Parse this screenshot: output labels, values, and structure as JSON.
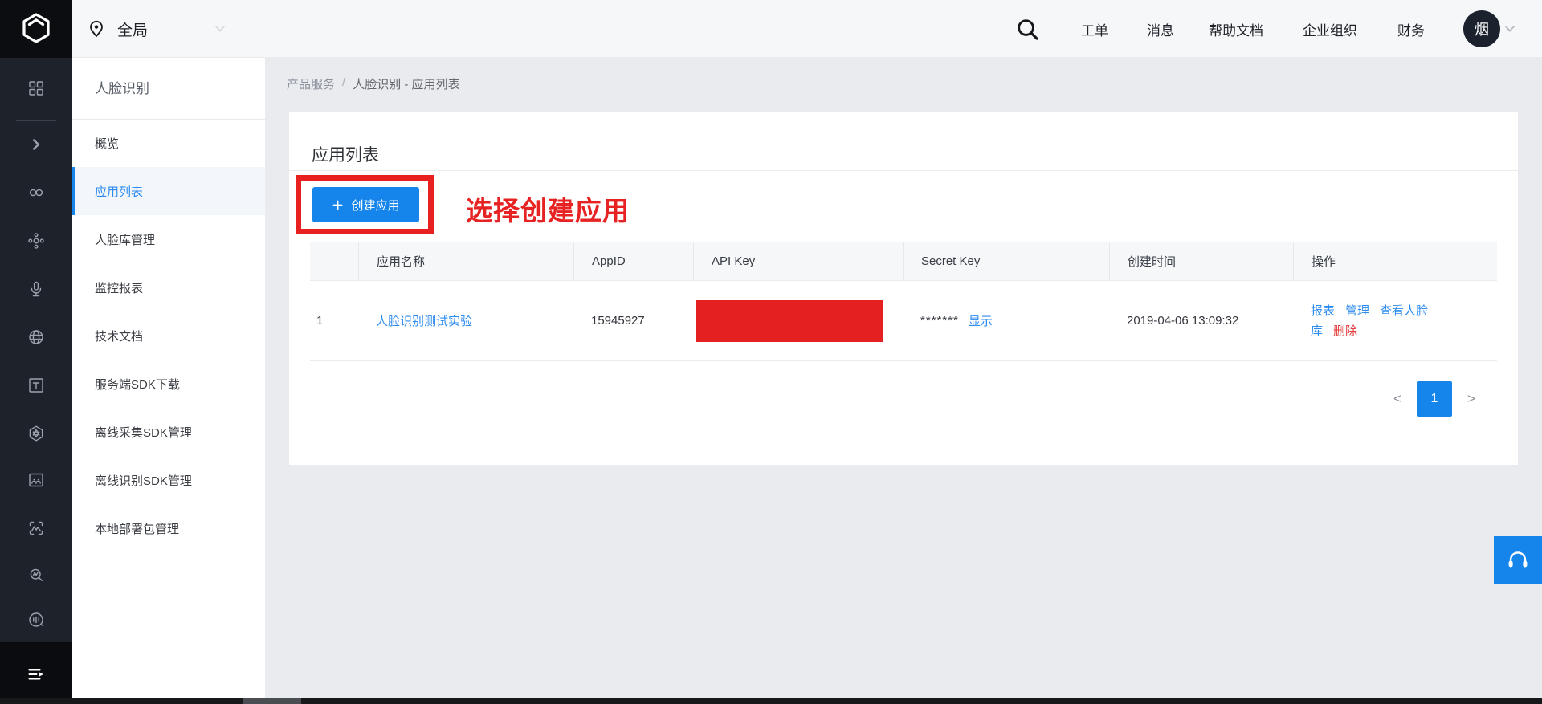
{
  "topbar": {
    "region_label": "全局",
    "nav": [
      "工单",
      "消息",
      "帮助文档",
      "企业组织",
      "财务"
    ],
    "avatar_text": "烟"
  },
  "rail_icons": [
    "grid-products",
    "collapse-chevron",
    "infinity",
    "node-cluster",
    "microphone",
    "face-globe",
    "text-recognition",
    "star-hexagon",
    "image-recognition",
    "face-scan",
    "search-wave",
    "voice-circle",
    "list-menu"
  ],
  "sidebar": {
    "title": "人脸识别",
    "items": [
      {
        "label": "概览"
      },
      {
        "label": "应用列表"
      },
      {
        "label": "人脸库管理"
      },
      {
        "label": "监控报表"
      },
      {
        "label": "技术文档"
      },
      {
        "label": "服务端SDK下载"
      },
      {
        "label": "离线采集SDK管理"
      },
      {
        "label": "离线识别SDK管理"
      },
      {
        "label": "本地部署包管理"
      }
    ]
  },
  "breadcrumb": {
    "root": "产品服务",
    "sep": "/",
    "current": "人脸识别 - 应用列表"
  },
  "main": {
    "card_title": "应用列表",
    "create_button_label": "创建应用",
    "annotation_text": "选择创建应用",
    "table": {
      "headers": [
        "",
        "应用名称",
        "AppID",
        "API Key",
        "Secret Key",
        "创建时间",
        "操作"
      ],
      "rows": [
        {
          "index": "1",
          "name": "人脸识别测试实验",
          "app_id": "15945927",
          "secret_mask": "*******",
          "secret_toggle": "显示",
          "created": "2019-04-06 13:09:32",
          "ops": [
            "报表",
            "管理",
            "查看人脸库",
            "删除"
          ]
        }
      ]
    },
    "pagination": {
      "prev": "<",
      "page": "1",
      "next": ">"
    }
  },
  "colors": {
    "accent_blue": "#1585ec",
    "link_blue": "#2d8cf0",
    "annotation_red": "#e82020",
    "redaction_red": "#e42020",
    "danger_red": "#e23c3c",
    "rail_bg": "#1e222b",
    "avatar_bg": "#1b222e",
    "content_bg": "#e9ebef"
  }
}
